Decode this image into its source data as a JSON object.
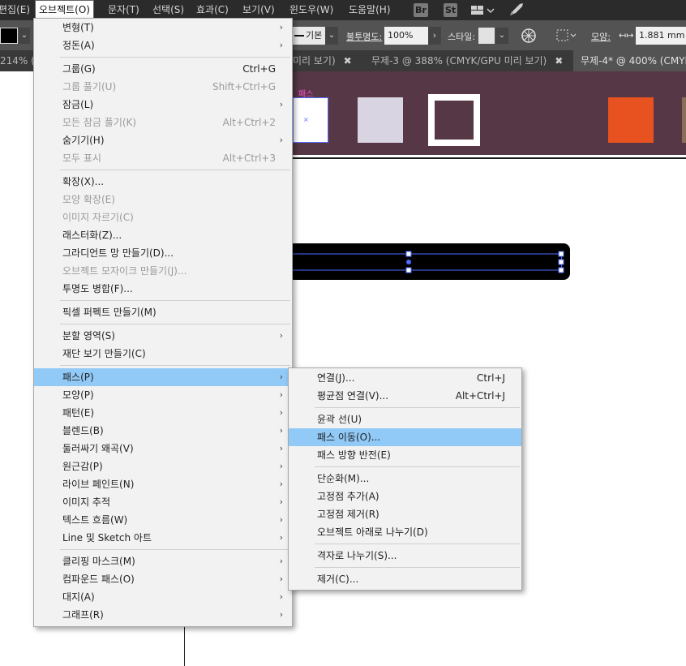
{
  "menubar": {
    "items": [
      "편집(E)",
      "오브젝트(O)",
      "문자(T)",
      "선택(S)",
      "효과(C)",
      "보기(V)",
      "윈도우(W)",
      "도움말(H)"
    ],
    "badges": [
      "Br",
      "St"
    ]
  },
  "controlbar": {
    "stroke_style": "기본",
    "opacity_label": "불투명도:",
    "opacity_value": "100%",
    "style_label": "스타일:",
    "shape_label": "모양:",
    "width_value": "1.881 mm"
  },
  "tabs": [
    {
      "label": "214% (",
      "active": false
    },
    {
      "label": "미리 보기)",
      "active": false
    },
    {
      "label": "무제-3 @ 388% (CMYK/GPU 미리 보기)",
      "active": false
    },
    {
      "label": "무제-4* @ 400% (CMYK",
      "active": true
    }
  ],
  "canvas": {
    "path_tag": "패스",
    "swatch_colors": [
      "#d8d4e2",
      "#e85220"
    ],
    "band_color": "#553745"
  },
  "object_menu": {
    "items": [
      {
        "label": "변형(T)",
        "arrow": true
      },
      {
        "label": "정돈(A)",
        "arrow": true
      },
      {
        "sep": true
      },
      {
        "label": "그룹(G)",
        "shortcut": "Ctrl+G"
      },
      {
        "label": "그룹 풀기(U)",
        "shortcut": "Shift+Ctrl+G",
        "disabled": true
      },
      {
        "label": "잠금(L)",
        "arrow": true
      },
      {
        "label": "모든 잠금 풀기(K)",
        "shortcut": "Alt+Ctrl+2",
        "disabled": true
      },
      {
        "label": "숨기기(H)",
        "arrow": true
      },
      {
        "label": "모두 표시",
        "shortcut": "Alt+Ctrl+3",
        "disabled": true
      },
      {
        "sep": true
      },
      {
        "label": "확장(X)..."
      },
      {
        "label": "모양 확장(E)",
        "disabled": true
      },
      {
        "label": "이미지 자르기(C)",
        "disabled": true
      },
      {
        "label": "래스터화(Z)..."
      },
      {
        "label": "그라디언트 망 만들기(D)..."
      },
      {
        "label": "오브젝트 모자이크 만들기(J)...",
        "disabled": true
      },
      {
        "label": "투명도 병합(F)..."
      },
      {
        "sep": true
      },
      {
        "label": "픽셀 퍼펙트 만들기(M)"
      },
      {
        "sep": true
      },
      {
        "label": "분할 영역(S)",
        "arrow": true
      },
      {
        "label": "재단 보기 만들기(C)"
      },
      {
        "sep": true
      },
      {
        "label": "패스(P)",
        "arrow": true,
        "highlighted": true
      },
      {
        "label": "모양(P)",
        "arrow": true
      },
      {
        "label": "패턴(E)",
        "arrow": true
      },
      {
        "label": "블렌드(B)",
        "arrow": true
      },
      {
        "label": "둘러싸기 왜곡(V)",
        "arrow": true
      },
      {
        "label": "원근감(P)",
        "arrow": true
      },
      {
        "label": "라이브 페인트(N)",
        "arrow": true
      },
      {
        "label": "이미지 추적",
        "arrow": true
      },
      {
        "label": "텍스트 흐름(W)",
        "arrow": true
      },
      {
        "label": "Line 및 Sketch 아트",
        "arrow": true
      },
      {
        "sep": true
      },
      {
        "label": "클리핑 마스크(M)",
        "arrow": true
      },
      {
        "label": "컴파운드 패스(O)",
        "arrow": true
      },
      {
        "label": "대지(A)",
        "arrow": true
      },
      {
        "label": "그래프(R)",
        "arrow": true
      }
    ]
  },
  "path_submenu": {
    "items": [
      {
        "label": "연결(J)...",
        "shortcut": "Ctrl+J"
      },
      {
        "label": "평균점 연결(V)...",
        "shortcut": "Alt+Ctrl+J"
      },
      {
        "sep": true
      },
      {
        "label": "윤곽 선(U)"
      },
      {
        "label": "패스 이동(O)...",
        "highlighted": true
      },
      {
        "label": "패스 방향 반전(E)"
      },
      {
        "sep": true
      },
      {
        "label": "단순화(M)..."
      },
      {
        "label": "고정점 추가(A)"
      },
      {
        "label": "고정점 제거(R)"
      },
      {
        "label": "오브젝트 아래로 나누기(D)"
      },
      {
        "sep": true
      },
      {
        "label": "격자로 나누기(S)..."
      },
      {
        "sep": true
      },
      {
        "label": "제거(C)..."
      }
    ]
  }
}
